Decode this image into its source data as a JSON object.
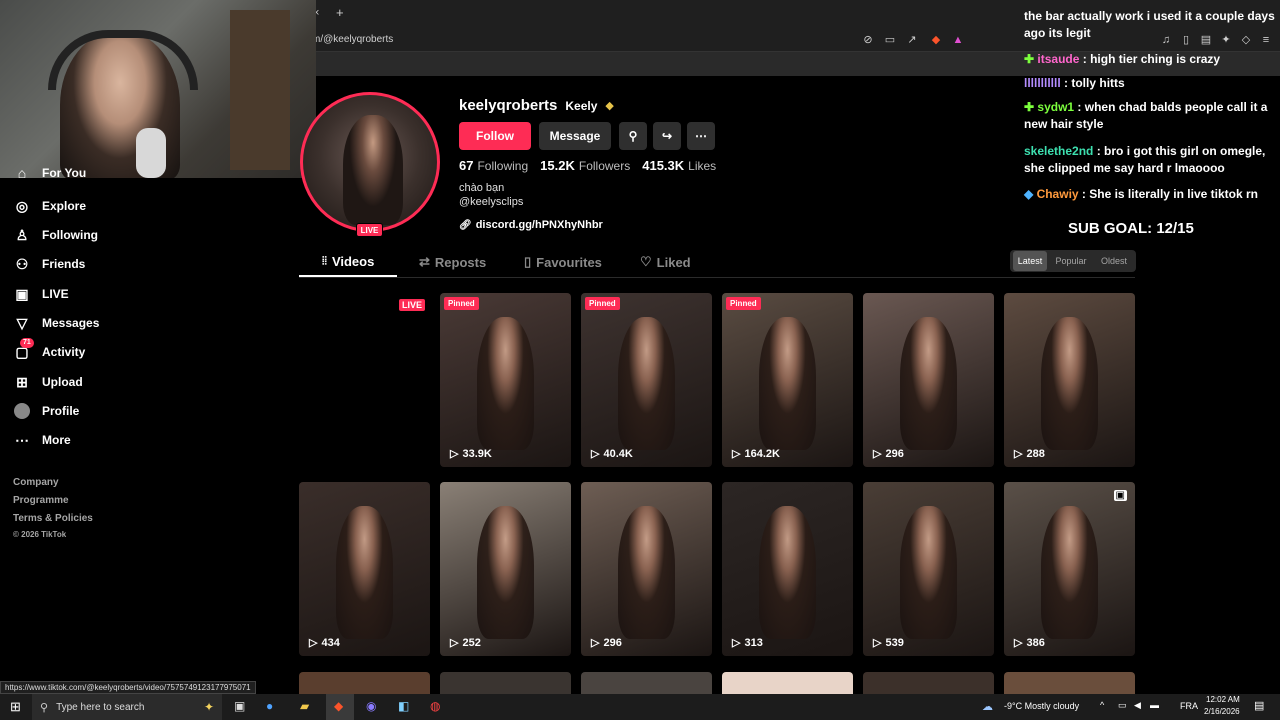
{
  "browser": {
    "url": "m/@keelyqroberts",
    "new_tab": "+",
    "close_tab": "×",
    "status_url": "https://www.tiktok.com/@keelyqroberts/video/7575749123177975071"
  },
  "sidebar": {
    "items": [
      {
        "label": "For You",
        "icon": "home-icon"
      },
      {
        "label": "Explore",
        "icon": "compass-icon"
      },
      {
        "label": "Following",
        "icon": "following-icon"
      },
      {
        "label": "Friends",
        "icon": "friends-icon"
      },
      {
        "label": "LIVE",
        "icon": "live-icon"
      },
      {
        "label": "Messages",
        "icon": "messages-icon"
      },
      {
        "label": "Activity",
        "icon": "activity-icon",
        "badge": "71"
      },
      {
        "label": "Upload",
        "icon": "upload-icon"
      },
      {
        "label": "Profile",
        "icon": "avatar-icon"
      },
      {
        "label": "More",
        "icon": "more-icon"
      }
    ],
    "footer": [
      "Company",
      "Programme",
      "Terms & Policies",
      "© 2026 TikTok"
    ]
  },
  "profile": {
    "username": "keelyqroberts",
    "display_name": "Keely",
    "follow_label": "Follow",
    "message_label": "Message",
    "live_label": "LIVE",
    "following_count": "67",
    "following_label": "Following",
    "followers_count": "15.2K",
    "followers_label": "Followers",
    "likes_count": "415.3K",
    "likes_label": "Likes",
    "bio_line1": "chào bạn",
    "bio_line2": "@keelysclips",
    "link": "discord.gg/hPNXhyNhbr"
  },
  "tabs": [
    {
      "label": "Videos",
      "active": true
    },
    {
      "label": "Reposts"
    },
    {
      "label": "Favourites"
    },
    {
      "label": "Liked"
    }
  ],
  "sort": {
    "latest": "Latest",
    "popular": "Popular",
    "oldest": "Oldest"
  },
  "live_tag": "LIVE",
  "pinned_label": "Pinned",
  "videos_row1": [
    {
      "views": "33.9K",
      "pinned": true,
      "tone": "#4a3a36"
    },
    {
      "views": "40.4K",
      "pinned": true,
      "tone": "#3e3330"
    },
    {
      "views": "164.2K",
      "pinned": true,
      "tone": "#5a4c42"
    },
    {
      "views": "296",
      "pinned": false,
      "tone": "#6a5852"
    },
    {
      "views": "288",
      "pinned": false,
      "tone": "#5d4b40"
    }
  ],
  "videos_row2": [
    {
      "views": "434",
      "tone": "#3a2e2a"
    },
    {
      "views": "252",
      "tone": "#8a8076"
    },
    {
      "views": "296",
      "tone": "#6e5e54"
    },
    {
      "views": "313",
      "tone": "#2c2624"
    },
    {
      "views": "539",
      "tone": "#4a3e36"
    },
    {
      "views": "386",
      "tone": "#5a5048"
    }
  ],
  "chat": [
    {
      "name": "",
      "color": "#ffffff",
      "text": "the bar actually work i used it a couple days ago its legit"
    },
    {
      "name": "itsaude",
      "color": "#ff66cc",
      "text": "high tier ching is crazy"
    },
    {
      "name": "lllllllllll",
      "color": "#b38cff",
      "text": "tolly hitts"
    },
    {
      "name": "sydw1",
      "color": "#7cff3d",
      "text": "when chad balds people call it a new hair style"
    },
    {
      "name": "skelethe2nd",
      "color": "#3de0b0",
      "text": "bro i got this girl on omegle, she clipped me say hard r lmaoooo"
    },
    {
      "name": "Chawiy",
      "color": "#ff9a3d",
      "text": "She is literally in live tiktok rn"
    }
  ],
  "sub_goal": "SUB GOAL: 12/15",
  "taskbar": {
    "search_placeholder": "Type here to search",
    "weather": "-9°C  Mostly cloudy",
    "lang": "FRA",
    "time": "12:02 AM",
    "date": "2/16/2026"
  }
}
